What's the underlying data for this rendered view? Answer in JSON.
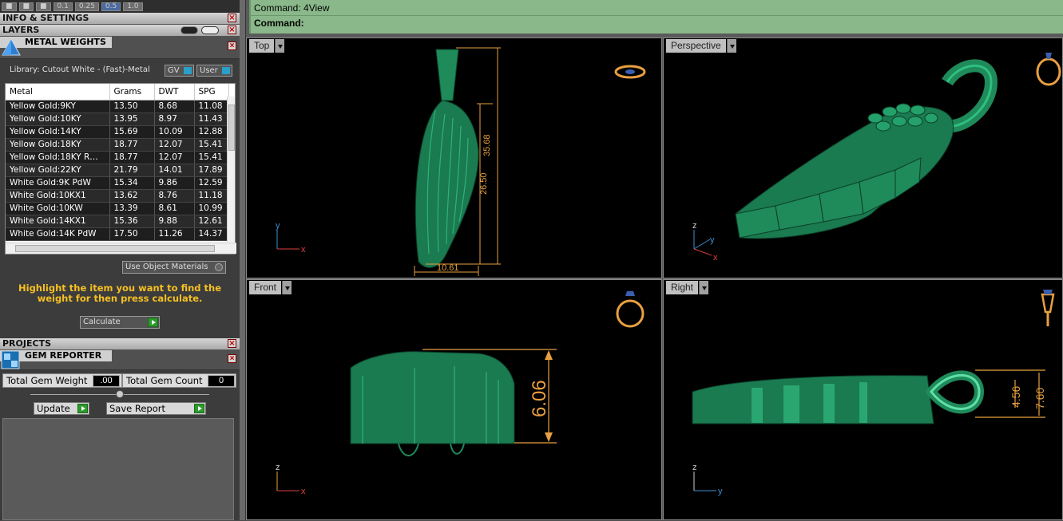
{
  "toolbar_strip": {
    "values": [
      "0.1",
      "0.25",
      "0.5",
      "1.0"
    ]
  },
  "left_panel": {
    "info_settings_label": "INFO & SETTINGS",
    "layers_label": "LAYERS",
    "metal_weights": {
      "title": "METAL WEIGHTS",
      "library": "Library: Cutout White - (Fast)-Metal",
      "gv_label": "GV",
      "user_label": "User",
      "columns": [
        "Metal",
        "Grams",
        "DWT",
        "SPG"
      ],
      "rows": [
        [
          "Yellow Gold:9KY",
          "13.50",
          "8.68",
          "11.08"
        ],
        [
          "Yellow Gold:10KY",
          "13.95",
          "8.97",
          "11.43"
        ],
        [
          "Yellow Gold:14KY",
          "15.69",
          "10.09",
          "12.88"
        ],
        [
          "Yellow Gold:18KY",
          "18.77",
          "12.07",
          "15.41"
        ],
        [
          "Yellow Gold:18KY R…",
          "18.77",
          "12.07",
          "15.41"
        ],
        [
          "Yellow Gold:22KY",
          "21.79",
          "14.01",
          "17.89"
        ],
        [
          "White Gold:9K PdW",
          "15.34",
          "9.86",
          "12.59"
        ],
        [
          "White Gold:10KX1",
          "13.62",
          "8.76",
          "11.18"
        ],
        [
          "White Gold:10KW",
          "13.39",
          "8.61",
          "10.99"
        ],
        [
          "White Gold:14KX1",
          "15.36",
          "9.88",
          "12.61"
        ],
        [
          "White Gold:14K PdW",
          "17.50",
          "11.26",
          "14.37"
        ]
      ],
      "use_object_materials": "Use Object Materials",
      "hint": "Highlight the item you want to find the weight for then press calculate.",
      "calculate_label": "Calculate"
    },
    "projects_label": "PROJECTS",
    "gem_reporter": {
      "title": "GEM REPORTER",
      "total_weight_label": "Total Gem Weight",
      "total_weight_value": ".00",
      "total_count_label": "Total Gem Count",
      "total_count_value": "0",
      "update_label": "Update",
      "save_report_label": "Save Report"
    }
  },
  "command": {
    "line1": "Command: 4View",
    "line2": "Command:"
  },
  "viewports": {
    "top": {
      "label": "Top",
      "dim_height_total": "35.68",
      "dim_height_wing": "26.50",
      "dim_width": "10.61",
      "axis_x": "x",
      "axis_y": "y"
    },
    "perspective": {
      "label": "Perspective",
      "axis_x": "x",
      "axis_y": "y",
      "axis_z": "z"
    },
    "front": {
      "label": "Front",
      "dim": "6.06",
      "axis_x": "x",
      "axis_z": "z"
    },
    "right": {
      "label": "Right",
      "dim_inner": "4.56",
      "dim_outer": "7.60",
      "axis_y": "y",
      "axis_z": "z"
    }
  },
  "colors": {
    "model": "#1f8a5a",
    "dimension": "#e8a040",
    "command_bar": "#8ab88a",
    "hint_text": "#f5c022"
  }
}
